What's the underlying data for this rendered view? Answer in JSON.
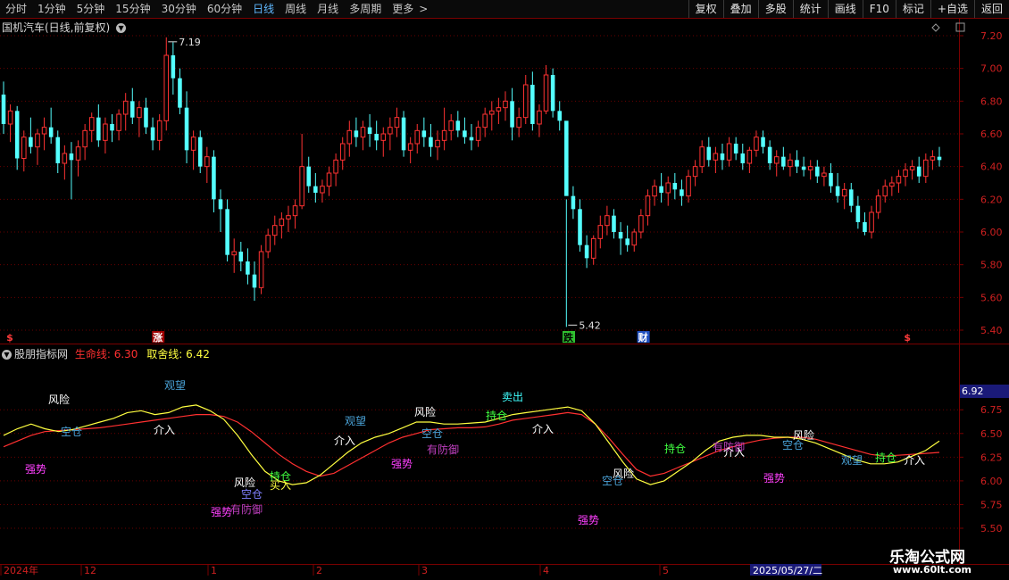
{
  "toolbar": {
    "periods": [
      {
        "label": "分时"
      },
      {
        "label": "1分钟"
      },
      {
        "label": "5分钟"
      },
      {
        "label": "15分钟"
      },
      {
        "label": "30分钟"
      },
      {
        "label": "60分钟"
      },
      {
        "label": "日线",
        "active": true
      },
      {
        "label": "周线"
      },
      {
        "label": "月线"
      },
      {
        "label": "多周期"
      },
      {
        "label": "更多"
      }
    ],
    "more_arrow": ">",
    "buttons": [
      "复权",
      "叠加",
      "多股",
      "统计",
      "画线",
      "F10",
      "标记",
      "+自选",
      "返回"
    ]
  },
  "main_chart": {
    "title": "国机汽车(日线,前复权)",
    "price_axis": [
      "7.20",
      "7.00",
      "6.80",
      "6.60",
      "6.40",
      "6.20",
      "6.00",
      "5.80",
      "5.60",
      "5.40"
    ],
    "high_label": "7.19",
    "low_label": "5.42",
    "markers": [
      {
        "text": "$",
        "color": "#ff3b3b"
      },
      {
        "text": "涨",
        "color": "#ffffff",
        "bg": "#a00000"
      },
      {
        "text": "跌",
        "color": "#000000",
        "bg": "#30c030"
      },
      {
        "text": "财",
        "color": "#ffffff",
        "bg": "#2050c0"
      },
      {
        "text": "$",
        "color": "#ff3b3b"
      }
    ]
  },
  "indicator": {
    "title": "股朋指标网",
    "line1_label": "生命线:",
    "line1_value": "6.30",
    "line2_label": "取舍线:",
    "line2_value": "6.42",
    "current_value": "6.92",
    "axis": [
      "6.75",
      "6.50",
      "6.25",
      "6.00",
      "5.75",
      "5.50"
    ],
    "signals": [
      {
        "text": "风险",
        "color": "#ffffff"
      },
      {
        "text": "观望",
        "color": "#4aa3d8"
      },
      {
        "text": "空仓",
        "color": "#4aa3d8"
      },
      {
        "text": "强势",
        "color": "#ff40ff"
      },
      {
        "text": "介入",
        "color": "#ffffff"
      },
      {
        "text": "风险",
        "color": "#ffffff"
      },
      {
        "text": "空仓",
        "color": "#8080ff"
      },
      {
        "text": "持仓",
        "color": "#40ff40"
      },
      {
        "text": "买入",
        "color": "#ffff40"
      },
      {
        "text": "有防御",
        "color": "#c040c0"
      },
      {
        "text": "强势",
        "color": "#ff40ff"
      },
      {
        "text": "介入",
        "color": "#ffffff"
      },
      {
        "text": "观望",
        "color": "#4aa3d8"
      },
      {
        "text": "风险",
        "color": "#ffffff"
      },
      {
        "text": "空仓",
        "color": "#4aa3d8"
      },
      {
        "text": "有防御",
        "color": "#c040c0"
      },
      {
        "text": "强势",
        "color": "#ff40ff"
      },
      {
        "text": "卖出",
        "color": "#40ffff"
      },
      {
        "text": "持仓",
        "color": "#40ff40"
      },
      {
        "text": "介入",
        "color": "#ffffff"
      },
      {
        "text": "风险",
        "color": "#ffffff"
      },
      {
        "text": "空仓",
        "color": "#4aa3d8"
      },
      {
        "text": "强势",
        "color": "#ff40ff"
      },
      {
        "text": "持仓",
        "color": "#40ff40"
      },
      {
        "text": "有防御",
        "color": "#c040c0"
      },
      {
        "text": "介入",
        "color": "#ffffff"
      },
      {
        "text": "强势",
        "color": "#ff40ff"
      },
      {
        "text": "空仓",
        "color": "#4aa3d8"
      },
      {
        "text": "风险",
        "color": "#ffffff"
      },
      {
        "text": "观望",
        "color": "#4aa3d8"
      },
      {
        "text": "持仓",
        "color": "#40ff40"
      },
      {
        "text": "介入",
        "color": "#ffffff"
      }
    ]
  },
  "date_axis": {
    "labels": [
      "2024年",
      "12",
      "1",
      "2",
      "3",
      "4",
      "5"
    ],
    "cursor_date": "2025/05/27/二"
  },
  "watermark": {
    "name": "乐淘公式网",
    "url": "www.60lt.com"
  },
  "chart_data": {
    "type": "candlestick",
    "title": "国机汽车(日线,前复权)",
    "y_range": [
      5.4,
      7.2
    ],
    "high": 7.19,
    "low": 5.42,
    "colors": {
      "up": "#ff3232",
      "down": "#54ffff"
    },
    "candles": [
      [
        6.84,
        6.92,
        6.6,
        6.66
      ],
      [
        6.66,
        6.78,
        6.55,
        6.74
      ],
      [
        6.74,
        6.77,
        6.38,
        6.45
      ],
      [
        6.45,
        6.62,
        6.37,
        6.58
      ],
      [
        6.58,
        6.7,
        6.48,
        6.52
      ],
      [
        6.52,
        6.63,
        6.41,
        6.6
      ],
      [
        6.6,
        6.7,
        6.5,
        6.64
      ],
      [
        6.64,
        6.76,
        6.54,
        6.58
      ],
      [
        6.58,
        6.62,
        6.36,
        6.42
      ],
      [
        6.42,
        6.53,
        6.32,
        6.48
      ],
      [
        6.48,
        6.55,
        6.2,
        6.44
      ],
      [
        6.44,
        6.56,
        6.34,
        6.52
      ],
      [
        6.52,
        6.66,
        6.44,
        6.62
      ],
      [
        6.62,
        6.73,
        6.55,
        6.7
      ],
      [
        6.7,
        6.78,
        6.52,
        6.56
      ],
      [
        6.56,
        6.7,
        6.48,
        6.66
      ],
      [
        6.66,
        6.72,
        6.55,
        6.62
      ],
      [
        6.62,
        6.75,
        6.56,
        6.72
      ],
      [
        6.72,
        6.85,
        6.62,
        6.8
      ],
      [
        6.8,
        6.88,
        6.66,
        6.7
      ],
      [
        6.7,
        6.8,
        6.58,
        6.76
      ],
      [
        6.76,
        6.82,
        6.6,
        6.64
      ],
      [
        6.64,
        6.7,
        6.5,
        6.56
      ],
      [
        6.56,
        6.72,
        6.5,
        6.68
      ],
      [
        6.68,
        7.19,
        6.62,
        7.08
      ],
      [
        7.08,
        7.16,
        6.84,
        6.94
      ],
      [
        6.94,
        7.0,
        6.72,
        6.76
      ],
      [
        6.76,
        6.86,
        6.42,
        6.5
      ],
      [
        6.5,
        6.62,
        6.38,
        6.58
      ],
      [
        6.58,
        6.62,
        6.36,
        6.4
      ],
      [
        6.4,
        6.52,
        6.3,
        6.46
      ],
      [
        6.46,
        6.5,
        6.12,
        6.2
      ],
      [
        6.2,
        6.26,
        6.0,
        6.14
      ],
      [
        6.14,
        6.2,
        5.82,
        5.86
      ],
      [
        5.86,
        5.96,
        5.75,
        5.88
      ],
      [
        5.88,
        5.94,
        5.76,
        5.82
      ],
      [
        5.82,
        5.9,
        5.68,
        5.74
      ],
      [
        5.74,
        5.82,
        5.58,
        5.66
      ],
      [
        5.66,
        5.92,
        5.62,
        5.88
      ],
      [
        5.88,
        6.02,
        5.84,
        5.98
      ],
      [
        5.98,
        6.1,
        5.92,
        6.04
      ],
      [
        6.04,
        6.12,
        5.96,
        6.08
      ],
      [
        6.08,
        6.16,
        6.0,
        6.1
      ],
      [
        6.1,
        6.2,
        6.02,
        6.16
      ],
      [
        6.16,
        6.6,
        6.14,
        6.4
      ],
      [
        6.4,
        6.46,
        6.24,
        6.28
      ],
      [
        6.28,
        6.36,
        6.18,
        6.24
      ],
      [
        6.24,
        6.32,
        6.18,
        6.28
      ],
      [
        6.28,
        6.4,
        6.22,
        6.36
      ],
      [
        6.36,
        6.48,
        6.28,
        6.44
      ],
      [
        6.44,
        6.58,
        6.38,
        6.54
      ],
      [
        6.54,
        6.68,
        6.46,
        6.62
      ],
      [
        6.62,
        6.7,
        6.52,
        6.58
      ],
      [
        6.58,
        6.68,
        6.5,
        6.64
      ],
      [
        6.64,
        6.72,
        6.52,
        6.6
      ],
      [
        6.6,
        6.68,
        6.5,
        6.56
      ],
      [
        6.56,
        6.64,
        6.46,
        6.6
      ],
      [
        6.6,
        6.7,
        6.5,
        6.64
      ],
      [
        6.64,
        6.76,
        6.58,
        6.7
      ],
      [
        6.7,
        6.74,
        6.46,
        6.5
      ],
      [
        6.5,
        6.58,
        6.42,
        6.54
      ],
      [
        6.54,
        6.66,
        6.48,
        6.62
      ],
      [
        6.62,
        6.7,
        6.52,
        6.58
      ],
      [
        6.58,
        6.66,
        6.46,
        6.52
      ],
      [
        6.52,
        6.62,
        6.44,
        6.56
      ],
      [
        6.56,
        6.76,
        6.5,
        6.62
      ],
      [
        6.62,
        6.72,
        6.56,
        6.68
      ],
      [
        6.68,
        6.74,
        6.58,
        6.62
      ],
      [
        6.62,
        6.7,
        6.54,
        6.58
      ],
      [
        6.58,
        6.66,
        6.5,
        6.56
      ],
      [
        6.56,
        6.68,
        6.52,
        6.64
      ],
      [
        6.64,
        6.76,
        6.58,
        6.72
      ],
      [
        6.72,
        6.8,
        6.62,
        6.74
      ],
      [
        6.74,
        6.82,
        6.66,
        6.76
      ],
      [
        6.76,
        6.86,
        6.68,
        6.8
      ],
      [
        6.8,
        6.88,
        6.56,
        6.64
      ],
      [
        6.64,
        6.76,
        6.58,
        6.7
      ],
      [
        6.7,
        6.96,
        6.66,
        6.9
      ],
      [
        6.9,
        6.98,
        6.62,
        6.66
      ],
      [
        6.66,
        6.78,
        6.58,
        6.74
      ],
      [
        6.74,
        7.02,
        6.72,
        6.96
      ],
      [
        6.96,
        7.0,
        6.7,
        6.74
      ],
      [
        6.74,
        6.8,
        6.62,
        6.68
      ],
      [
        6.68,
        6.2,
        5.42,
        6.22
      ],
      [
        6.22,
        6.28,
        6.08,
        6.14
      ],
      [
        6.14,
        6.2,
        5.88,
        5.92
      ],
      [
        5.92,
        5.98,
        5.78,
        5.84
      ],
      [
        5.84,
        5.98,
        5.8,
        5.96
      ],
      [
        5.96,
        6.1,
        5.9,
        6.04
      ],
      [
        6.04,
        6.16,
        5.98,
        6.1
      ],
      [
        6.1,
        6.14,
        5.96,
        6.0
      ],
      [
        6.0,
        6.06,
        5.86,
        5.96
      ],
      [
        5.96,
        6.04,
        5.88,
        5.92
      ],
      [
        5.92,
        6.02,
        5.88,
        6.0
      ],
      [
        6.0,
        6.14,
        5.96,
        6.1
      ],
      [
        6.1,
        6.26,
        6.04,
        6.22
      ],
      [
        6.22,
        6.32,
        6.16,
        6.28
      ],
      [
        6.28,
        6.36,
        6.18,
        6.24
      ],
      [
        6.24,
        6.34,
        6.16,
        6.3
      ],
      [
        6.3,
        6.36,
        6.2,
        6.26
      ],
      [
        6.26,
        6.32,
        6.16,
        6.22
      ],
      [
        6.22,
        6.38,
        6.18,
        6.34
      ],
      [
        6.34,
        6.44,
        6.28,
        6.4
      ],
      [
        6.4,
        6.56,
        6.36,
        6.52
      ],
      [
        6.52,
        6.58,
        6.4,
        6.44
      ],
      [
        6.44,
        6.52,
        6.36,
        6.48
      ],
      [
        6.48,
        6.54,
        6.38,
        6.44
      ],
      [
        6.44,
        6.58,
        6.4,
        6.54
      ],
      [
        6.54,
        6.58,
        6.44,
        6.48
      ],
      [
        6.48,
        6.54,
        6.38,
        6.42
      ],
      [
        6.42,
        6.52,
        6.36,
        6.5
      ],
      [
        6.5,
        6.62,
        6.46,
        6.58
      ],
      [
        6.58,
        6.62,
        6.48,
        6.52
      ],
      [
        6.52,
        6.56,
        6.38,
        6.42
      ],
      [
        6.42,
        6.5,
        6.34,
        6.46
      ],
      [
        6.46,
        6.52,
        6.38,
        6.4
      ],
      [
        6.4,
        6.48,
        6.34,
        6.44
      ],
      [
        6.44,
        6.5,
        6.36,
        6.4
      ],
      [
        6.4,
        6.46,
        6.34,
        6.38
      ],
      [
        6.38,
        6.44,
        6.32,
        6.4
      ],
      [
        6.4,
        6.44,
        6.3,
        6.34
      ],
      [
        6.34,
        6.4,
        6.28,
        6.36
      ],
      [
        6.36,
        6.42,
        6.24,
        6.28
      ],
      [
        6.28,
        6.36,
        6.18,
        6.22
      ],
      [
        6.22,
        6.3,
        6.14,
        6.26
      ],
      [
        6.26,
        6.3,
        6.12,
        6.16
      ],
      [
        6.16,
        6.22,
        6.02,
        6.06
      ],
      [
        6.06,
        6.12,
        5.98,
        6.0
      ],
      [
        6.0,
        6.16,
        5.96,
        6.12
      ],
      [
        6.12,
        6.26,
        6.08,
        6.22
      ],
      [
        6.22,
        6.32,
        6.18,
        6.28
      ],
      [
        6.28,
        6.34,
        6.22,
        6.3
      ],
      [
        6.3,
        6.38,
        6.24,
        6.34
      ],
      [
        6.34,
        6.42,
        6.28,
        6.38
      ],
      [
        6.38,
        6.44,
        6.32,
        6.4
      ],
      [
        6.4,
        6.46,
        6.3,
        6.34
      ],
      [
        6.34,
        6.48,
        6.3,
        6.44
      ],
      [
        6.44,
        6.5,
        6.38,
        6.46
      ],
      [
        6.46,
        6.52,
        6.4,
        6.44
      ]
    ],
    "indicator_axis_range": [
      5.5,
      6.95
    ],
    "series": [
      {
        "name": "生命线",
        "value": 6.3,
        "color": "#ff3030",
        "values": [
          6.36,
          6.42,
          6.48,
          6.52,
          6.53,
          6.54,
          6.55,
          6.56,
          6.58,
          6.6,
          6.62,
          6.64,
          6.66,
          6.68,
          6.7,
          6.7,
          6.68,
          6.62,
          6.52,
          6.4,
          6.28,
          6.18,
          6.1,
          6.05,
          6.08,
          6.16,
          6.24,
          6.32,
          6.4,
          6.46,
          6.5,
          6.54,
          6.55,
          6.56,
          6.56,
          6.57,
          6.6,
          6.64,
          6.66,
          6.68,
          6.7,
          6.72,
          6.7,
          6.6,
          6.45,
          6.28,
          6.12,
          6.05,
          6.08,
          6.14,
          6.2,
          6.26,
          6.32,
          6.36,
          6.4,
          6.43,
          6.45,
          6.46,
          6.46,
          6.44,
          6.4,
          6.36,
          6.32,
          6.28,
          6.26,
          6.27,
          6.28,
          6.29,
          6.3
        ]
      },
      {
        "name": "取舍线",
        "value": 6.42,
        "color": "#ffff40",
        "values": [
          6.48,
          6.55,
          6.6,
          6.55,
          6.52,
          6.54,
          6.58,
          6.62,
          6.66,
          6.72,
          6.74,
          6.7,
          6.72,
          6.78,
          6.8,
          6.74,
          6.65,
          6.48,
          6.28,
          6.1,
          6.0,
          5.96,
          5.98,
          6.06,
          6.18,
          6.3,
          6.4,
          6.46,
          6.5,
          6.56,
          6.62,
          6.62,
          6.6,
          6.6,
          6.61,
          6.62,
          6.66,
          6.7,
          6.72,
          6.74,
          6.76,
          6.78,
          6.74,
          6.6,
          6.4,
          6.2,
          6.02,
          5.96,
          6.0,
          6.1,
          6.2,
          6.32,
          6.42,
          6.46,
          6.48,
          6.48,
          6.46,
          6.46,
          6.44,
          6.4,
          6.34,
          6.28,
          6.22,
          6.18,
          6.18,
          6.2,
          6.26,
          6.32,
          6.42
        ]
      }
    ]
  }
}
